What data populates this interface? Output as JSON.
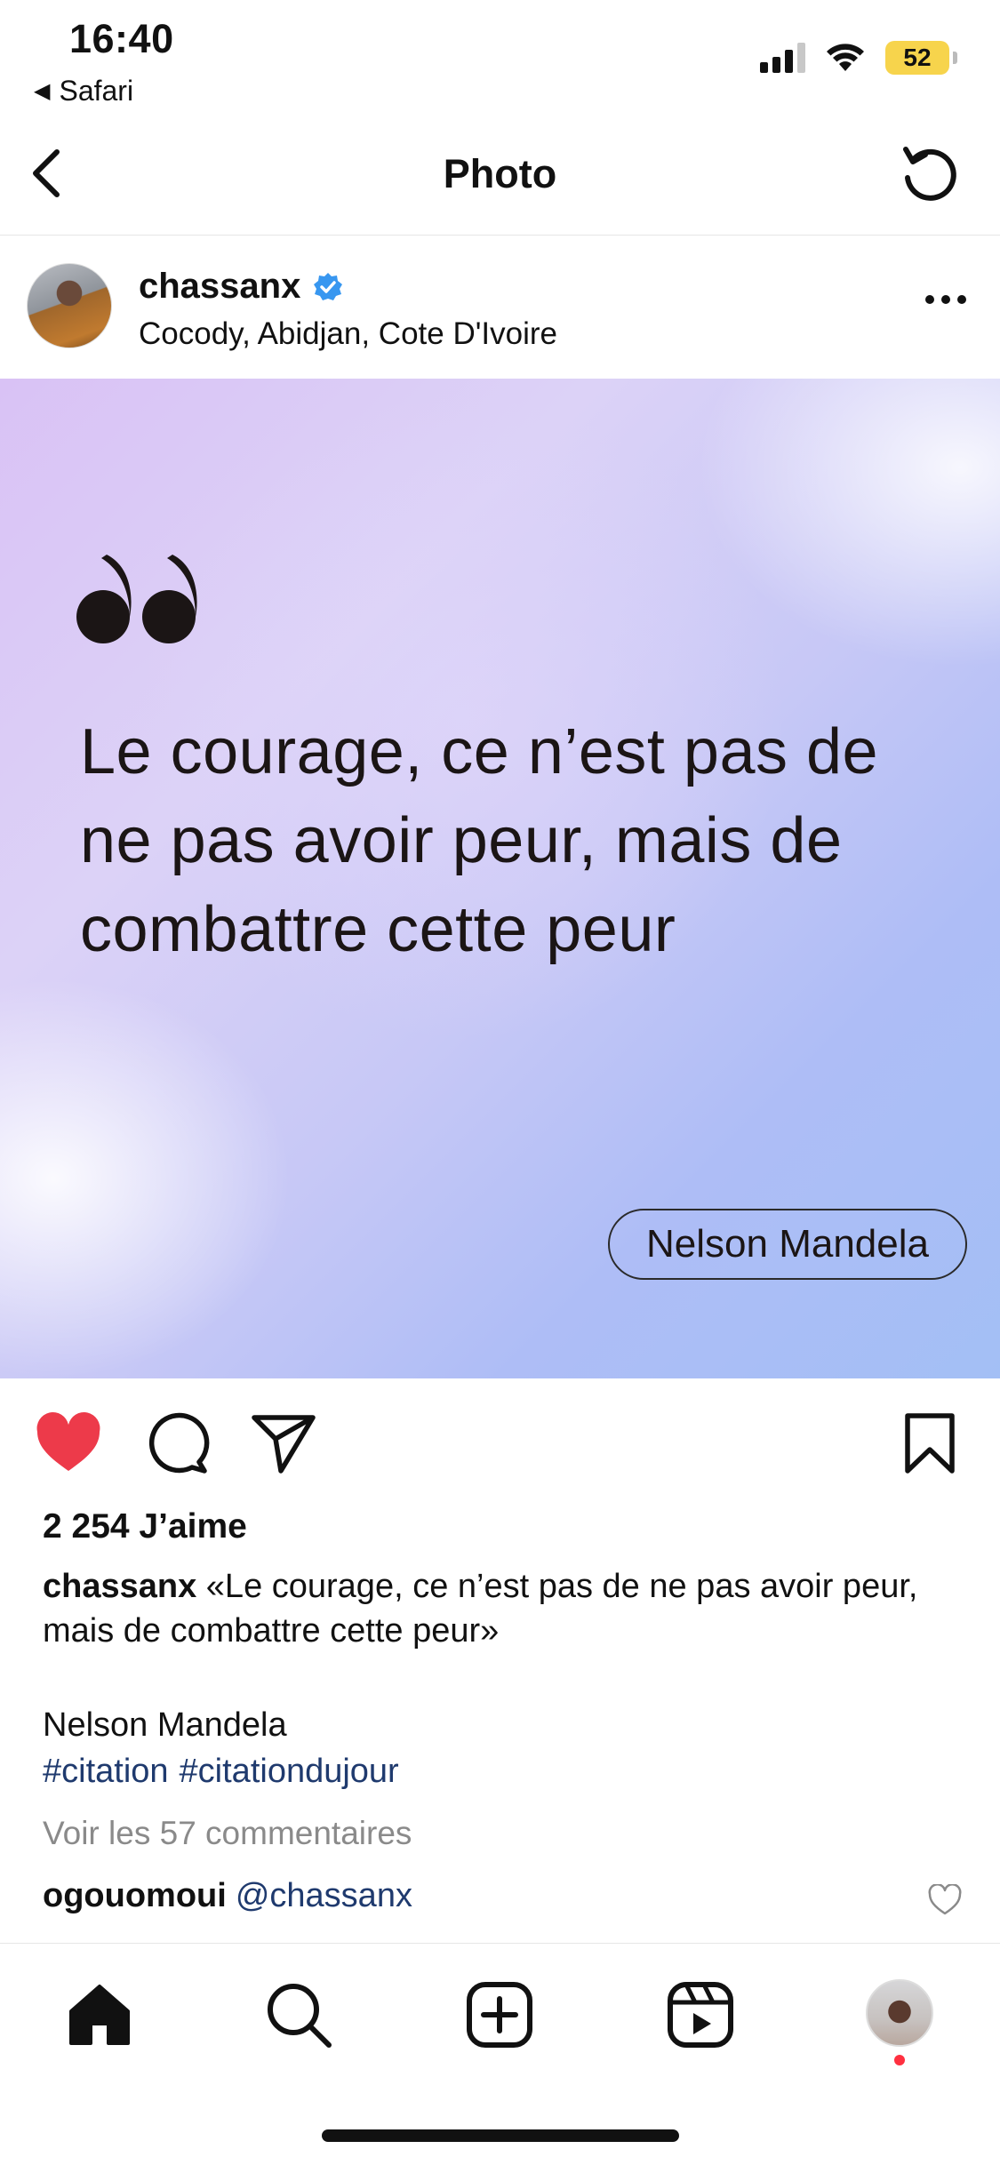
{
  "status_bar": {
    "time": "16:40",
    "back_app": "Safari",
    "battery_level": "52",
    "battery_color": "#f7d44c"
  },
  "nav": {
    "title": "Photo"
  },
  "post": {
    "username": "chassanx",
    "verified": true,
    "location": "Cocody, Abidjan, Cote D'Ivoire",
    "image": {
      "quote": "Le courage, ce n’est pas de ne pas avoir peur, mais de combattre cette peur",
      "author": "Nelson Mandela"
    },
    "liked": true,
    "like_color": "#ed3a4a",
    "likes_text": "2 254 J’aime",
    "caption_user": "chassanx",
    "caption_text": "«Le courage, ce n’est pas de ne pas avoir peur, mais de combattre cette peur»",
    "caption_author": "Nelson Mandela",
    "hashtags": [
      "#citation",
      "#citationdujour"
    ],
    "hashtag_color": "#1f3a6e",
    "comments_link": "Voir les 57 commentaires",
    "top_comment": {
      "user": "ogouomoui",
      "text": "@chassanx"
    }
  },
  "tabbar": {
    "icons": [
      "home-icon",
      "search-icon",
      "create-icon",
      "reels-icon",
      "profile-avatar"
    ],
    "notification_dot_color": "#ff3040"
  }
}
